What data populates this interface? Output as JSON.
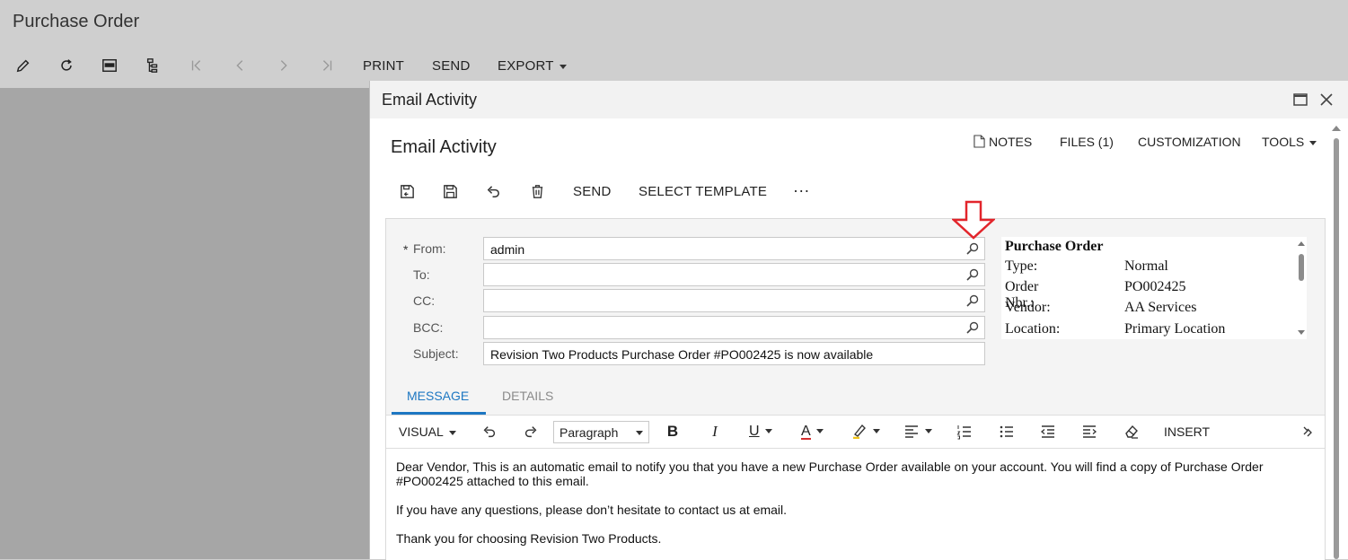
{
  "page": {
    "title": "Purchase Order"
  },
  "bg_toolbar": {
    "icons": [
      "edit-icon",
      "refresh-icon",
      "pdf-icon",
      "hierarchy-icon",
      "first-record-icon",
      "previous-record-icon",
      "next-record-icon",
      "last-record-icon"
    ],
    "print_label": "PRINT",
    "send_label": "SEND",
    "export_label": "EXPORT"
  },
  "dialog": {
    "title": "Email Activity",
    "form_title": "Email Activity",
    "links": {
      "notes": "NOTES",
      "files": "FILES (1)",
      "customization": "CUSTOMIZATION",
      "tools": "TOOLS"
    },
    "toolbar": {
      "icons": [
        "save-close-icon",
        "save-icon",
        "undo-icon",
        "delete-icon"
      ],
      "send_label": "SEND",
      "select_template_label": "SELECT TEMPLATE",
      "more_label": "···"
    },
    "fields": {
      "required_mark": "*",
      "from": {
        "label": "From:",
        "value": "admin"
      },
      "to": {
        "label": "To:",
        "value": ""
      },
      "cc": {
        "label": "CC:",
        "value": ""
      },
      "bcc": {
        "label": "BCC:",
        "value": ""
      },
      "subject": {
        "label": "Subject:",
        "value": "Revision Two Products Purchase Order #PO002425 is now available"
      }
    },
    "summary": {
      "title": "Purchase Order",
      "rows": [
        {
          "label": "Type:",
          "value": "Normal"
        },
        {
          "label": "Order Nbr.:",
          "value": "PO002425"
        },
        {
          "label": "Vendor:",
          "value": "AA Services"
        },
        {
          "label": "Location:",
          "value": "Primary Location"
        }
      ]
    },
    "tabs": [
      {
        "label": "MESSAGE",
        "active": true
      },
      {
        "label": "DETAILS",
        "active": false
      }
    ],
    "editor_toolbar": {
      "visual_label": "VISUAL",
      "paragraph_label": "Paragraph",
      "insert_label": "INSERT",
      "bold": "B",
      "italic": "I",
      "underline": "U",
      "font_color": "A"
    },
    "message": {
      "paragraphs": [
        "Dear Vendor, This is an automatic email to notify you that you have a new Purchase Order available on your account. You will find a copy of Purchase Order #PO002425 attached to this email.",
        "If you have any questions, please don’t hesitate to contact us at email.",
        "Thank you for choosing Revision Two Products."
      ]
    }
  },
  "colors": {
    "accent": "#1d77c2",
    "arrow": "#e2252b",
    "background": "#cfcfcf",
    "overlay": "#a6a6a6"
  }
}
